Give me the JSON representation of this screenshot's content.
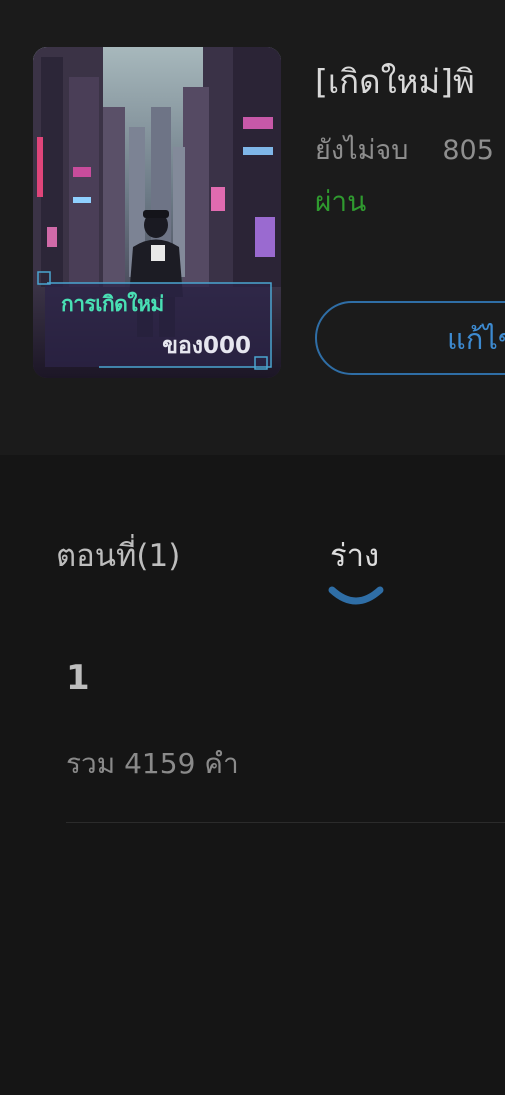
{
  "book": {
    "title": "[เกิดใหม่]พิ",
    "progress_status": "ยังไม่จบ",
    "view_count": "805",
    "review_status": "ผ่าน",
    "cover": {
      "line1": "การเกิดใหม่",
      "line2": "ของ000"
    }
  },
  "actions": {
    "edit_label": "แก้ไข"
  },
  "tabs": [
    {
      "label": "ตอนที่(1)"
    },
    {
      "label": "ร่าง"
    }
  ],
  "chapters": [
    {
      "number": "1",
      "word_count": "รวม 4159 คำ"
    }
  ],
  "colors": {
    "background": "#151515",
    "header_card": "#1b1b1b",
    "accent_blue": "#2f6ea6",
    "status_green": "#2f9a2f",
    "cover_caption_teal": "#49e0b4"
  }
}
